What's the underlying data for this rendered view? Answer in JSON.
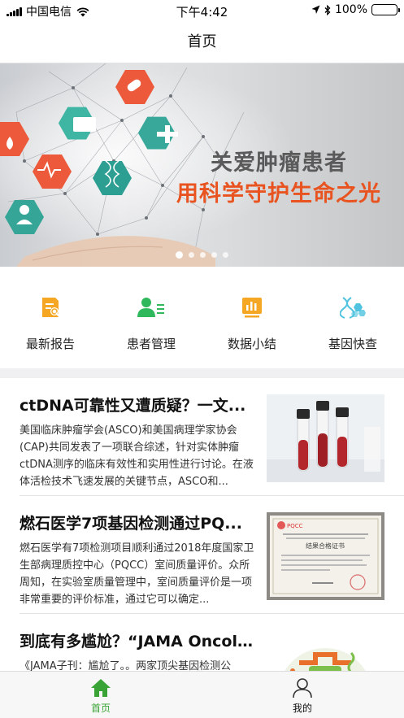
{
  "status_bar": {
    "carrier": "中国电信",
    "time": "下午4:42",
    "battery_percent": "100%",
    "battery_level": 1.0
  },
  "nav": {
    "title": "首页"
  },
  "banner": {
    "headline": "关爱肿瘤患者",
    "subheadline": "用科学守护生命之光",
    "headline_color": "#5a5a5a",
    "subheadline_color": "#e8531f",
    "page_count": 5,
    "active_page": 1
  },
  "quick_menu": [
    {
      "label": "最新报告",
      "icon": "report-icon"
    },
    {
      "label": "患者管理",
      "icon": "patient-icon"
    },
    {
      "label": "数据小结",
      "icon": "data-chart-icon"
    },
    {
      "label": "基因快查",
      "icon": "gene-icon"
    }
  ],
  "articles": [
    {
      "title": "ctDNA可靠性又遭质疑？一文...",
      "summary": "美国临床肿瘤学会(ASCO)和美国病理学家协会(CAP)共同发表了一项联合综述，针对实体肿瘤ctDNA测序的临床有效性和实用性进行讨论。在液体活检技术飞速发展的关键节点，ASCO和...",
      "thumbnail": "blood-tubes-image"
    },
    {
      "title": "燃石医学7项基因检测通过PQ...",
      "summary": "燃石医学有7项检测项目顺利通过2018年度国家卫生部病理质控中心（PQCC）室间质量评价。众所周知，在实验室质量管理中，室间质量评价是一项非常重要的评价标准，通过它可以确定...",
      "thumbnail": "certificate-image",
      "certificate": {
        "logo": "PQCC",
        "heading": "结果合格证书"
      }
    },
    {
      "title": "到底有多尴尬？“JAMA Oncol...",
      "summary": "《JAMA子刊：尴尬了。。两家顶尖基因检测公",
      "thumbnail": "gene-illustration-image"
    }
  ],
  "tab_bar": [
    {
      "label": "首页",
      "icon": "home-icon",
      "active": true
    },
    {
      "label": "我的",
      "icon": "profile-icon",
      "active": false
    }
  ],
  "colors": {
    "accent_green": "#3aa335",
    "menu_orange": "#f5a623",
    "menu_green": "#2fb85c",
    "menu_cyan": "#4fc3e0"
  }
}
